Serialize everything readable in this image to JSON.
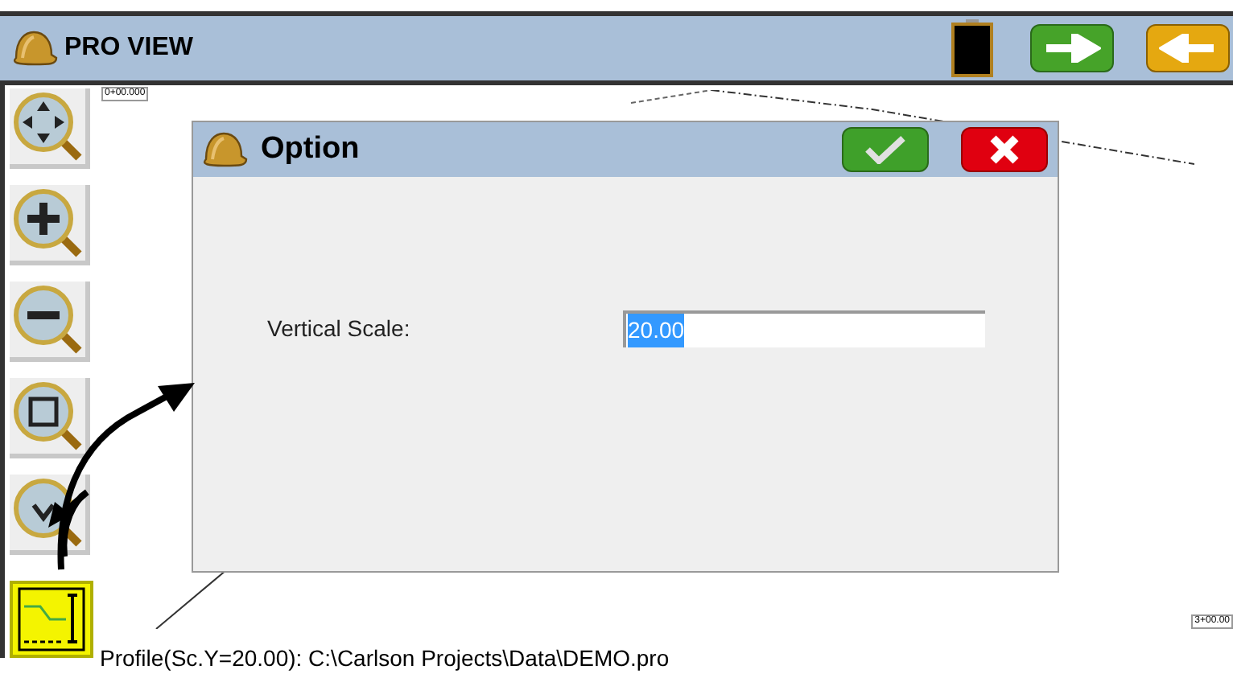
{
  "window": {
    "title": "PRO VIEW"
  },
  "header_buttons": [
    {
      "kind": "stop"
    },
    {
      "kind": "next"
    },
    {
      "kind": "back"
    }
  ],
  "toolbar": [
    {
      "kind": "pan",
      "selected": false
    },
    {
      "kind": "zoom-in",
      "selected": false
    },
    {
      "kind": "zoom-out",
      "selected": false
    },
    {
      "kind": "zoom-window",
      "selected": false
    },
    {
      "kind": "zoom-previous",
      "selected": false
    },
    {
      "kind": "profile",
      "selected": true
    }
  ],
  "canvas": {
    "start_station": "0+00.000",
    "end_station": "3+00.00"
  },
  "dialog": {
    "title": "Option",
    "fields": [
      {
        "label": "Vertical Scale:",
        "value": "20.00",
        "value_selected": true
      }
    ]
  },
  "status_bar": "Profile(Sc.Y=20.00): C:\\Carlson Projects\\Data\\DEMO.pro"
}
